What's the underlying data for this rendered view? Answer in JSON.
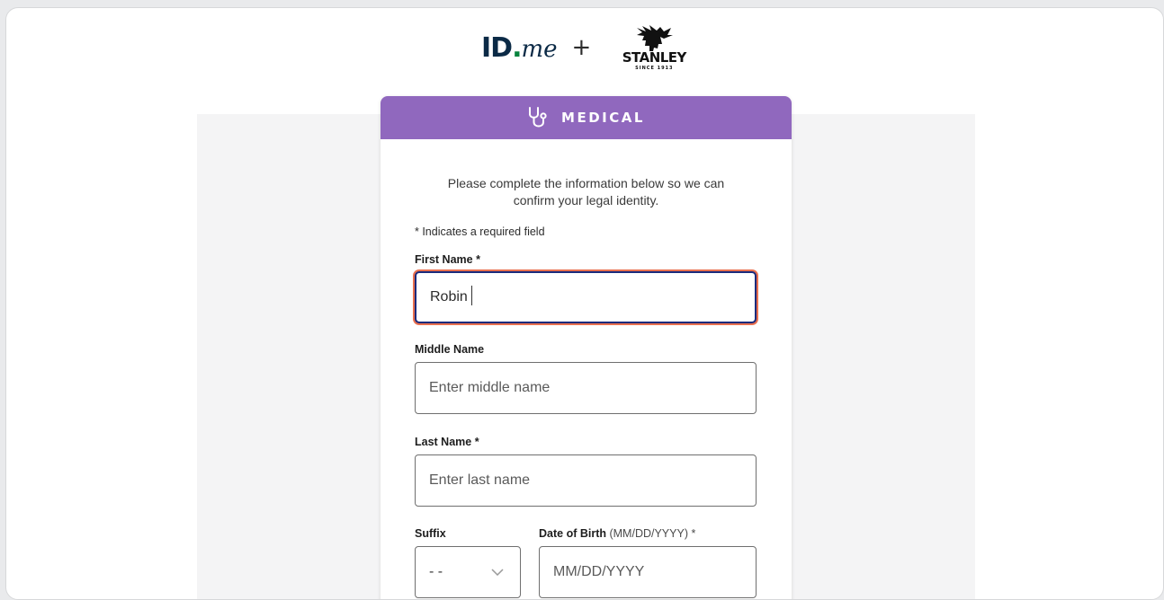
{
  "brand": {
    "idme_main": "ID",
    "idme_dot": ".",
    "idme_suffix": "me",
    "plus": "+",
    "partner_name": "STANLEY",
    "partner_tagline": "SINCE 1913"
  },
  "card": {
    "header_title": "MEDICAL",
    "intro": "Please complete the information below so we can confirm your legal identity.",
    "required_note": "* Indicates a required field"
  },
  "form": {
    "first_name": {
      "label": "First Name *",
      "value": "Robin"
    },
    "middle_name": {
      "label": "Middle Name",
      "placeholder": "Enter middle name"
    },
    "last_name": {
      "label": "Last Name *",
      "placeholder": "Enter last name"
    },
    "suffix": {
      "label": "Suffix",
      "selected": "- -"
    },
    "dob": {
      "label": "Date of Birth",
      "format": "(MM/DD/YYYY)",
      "required_mark": "*",
      "placeholder": "MM/DD/YYYY"
    }
  },
  "colors": {
    "header_purple": "#9068be",
    "focus_border": "#1a2a7c",
    "focus_ring": "#e9704f",
    "idme_green": "#08833d"
  },
  "icons": [
    "stethoscope-icon",
    "chevron-down-icon",
    "stanley-bear-icon"
  ]
}
